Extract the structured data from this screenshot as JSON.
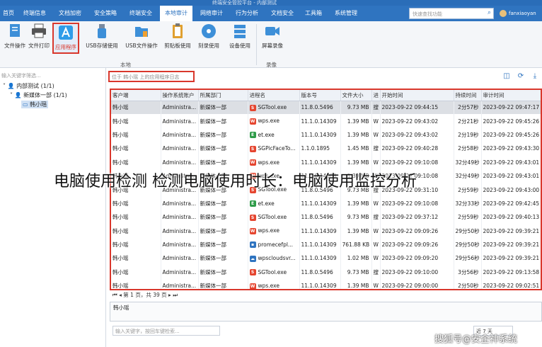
{
  "window": {
    "title": "终端安全管控平台 - 内部测试"
  },
  "menubar": {
    "items": [
      "首页",
      "终端信息",
      "文档加密",
      "安全策略",
      "终端安全",
      "本地审计",
      "网络审计",
      "行为分析",
      "文档安全",
      "工具箱",
      "系统管理"
    ],
    "active_index": 5,
    "search_placeholder": "快速查找功能",
    "username": "fanxiaoyan"
  },
  "toolbar": {
    "buttons": [
      {
        "label": "文件操作",
        "icon": "file-operation-icon"
      },
      {
        "label": "文件打印",
        "icon": "printer-icon"
      },
      {
        "label": "应用程序",
        "icon": "application-icon",
        "selected": true
      },
      {
        "label": "USB存储使用",
        "icon": "usb-storage-icon"
      },
      {
        "label": "USB文件操作",
        "icon": "usb-file-icon"
      },
      {
        "label": "剪贴板使用",
        "icon": "clipboard-icon"
      },
      {
        "label": "刻录使用",
        "icon": "disc-burn-icon"
      },
      {
        "label": "设备使用",
        "icon": "device-icon"
      },
      {
        "label": "屏幕录像",
        "icon": "screen-record-icon"
      }
    ],
    "group_local": "本地",
    "group_record": "录像"
  },
  "sidebar": {
    "search_placeholder": "输入关键字筛选...",
    "tree": [
      {
        "label": "内部测试 (1/1)",
        "level": 0
      },
      {
        "label": "新媒体一部 (1/1)",
        "level": 1
      },
      {
        "label": "韩小瑶",
        "level": 2,
        "selected": true
      }
    ]
  },
  "filter": {
    "text": "位于 韩小瑶 上的应用程序日志"
  },
  "table": {
    "columns": [
      "客户端",
      "操作系统账户",
      "所属部门",
      "进程名",
      "版本号",
      "文件大小",
      "进",
      "开始时间",
      "持续时间",
      "审计时间"
    ],
    "rows": [
      [
        "韩小瑶",
        "Administra...",
        "新媒体一部",
        "SGTool.exe",
        "11.8.0.5496",
        "9.73 MB",
        "搜",
        "2023-09-22 09:44:15",
        "2分57秒",
        "2023-09-22 09:47:17"
      ],
      [
        "韩小瑶",
        "Administra...",
        "新媒体一部",
        "wps.exe",
        "11.1.0.14309",
        "1.39 MB",
        "W",
        "2023-09-22 09:43:02",
        "2分21秒",
        "2023-09-22 09:45:26"
      ],
      [
        "韩小瑶",
        "Administra...",
        "新媒体一部",
        "et.exe",
        "11.1.0.14309",
        "1.39 MB",
        "W",
        "2023-09-22 09:43:02",
        "2分19秒",
        "2023-09-22 09:45:26"
      ],
      [
        "韩小瑶",
        "Administra...",
        "新媒体一部",
        "SGPicFaceTo...",
        "1.1.0.1895",
        "1.45 MB",
        "搜",
        "2023-09-22 09:40:28",
        "2分58秒",
        "2023-09-22 09:43:30"
      ],
      [
        "韩小瑶",
        "Administra...",
        "新媒体一部",
        "wps.exe",
        "11.1.0.14309",
        "1.39 MB",
        "W",
        "2023-09-22 09:10:08",
        "32分49秒",
        "2023-09-22 09:43:01"
      ],
      [
        "韩小瑶",
        "Administra...",
        "新媒体一部",
        "wps.exe",
        "11.1.0.14309",
        "1.39 MB",
        "W",
        "2023-09-22 09:10:08",
        "32分49秒",
        "2023-09-22 09:43:01"
      ],
      [
        "韩小瑶",
        "Administra...",
        "新媒体一部",
        "SGTool.exe",
        "11.8.0.5496",
        "9.73 MB",
        "搜",
        "2023-09-22 09:31:10",
        "2分59秒",
        "2023-09-22 09:43:00"
      ],
      [
        "韩小瑶",
        "Administra...",
        "新媒体一部",
        "et.exe",
        "11.1.0.14309",
        "1.39 MB",
        "W",
        "2023-09-22 09:10:08",
        "32分33秒",
        "2023-09-22 09:42:45"
      ],
      [
        "韩小瑶",
        "Administra...",
        "新媒体一部",
        "SGTool.exe",
        "11.8.0.5496",
        "9.73 MB",
        "搜",
        "2023-09-22 09:37:12",
        "2分59秒",
        "2023-09-22 09:40:13"
      ],
      [
        "韩小瑶",
        "Administra...",
        "新媒体一部",
        "wps.exe",
        "11.1.0.14309",
        "1.39 MB",
        "W",
        "2023-09-22 09:09:26",
        "29分50秒",
        "2023-09-22 09:39:21"
      ],
      [
        "韩小瑶",
        "Administra...",
        "新媒体一部",
        "promecefpl...",
        "11.1.0.14309",
        "761.88 KB",
        "W",
        "2023-09-22 09:09:26",
        "29分50秒",
        "2023-09-22 09:39:21"
      ],
      [
        "韩小瑶",
        "Administra...",
        "新媒体一部",
        "wpscloudsvr...",
        "11.1.0.14309",
        "1.02 MB",
        "W",
        "2023-09-22 09:09:20",
        "29分56秒",
        "2023-09-22 09:39:21"
      ],
      [
        "韩小瑶",
        "Administra...",
        "新媒体一部",
        "SGTool.exe",
        "11.8.0.5496",
        "9.73 MB",
        "搜",
        "2023-09-22 09:10:00",
        "3分56秒",
        "2023-09-22 09:13:58"
      ],
      [
        "韩小瑶",
        "Administra...",
        "新媒体一部",
        "wps.exe",
        "11.1.0.14309",
        "1.39 MB",
        "W",
        "2023-09-22 09:00:00",
        "2分50秒",
        "2023-09-22 09:02:51"
      ]
    ],
    "selected_row": 0,
    "process_icons": {
      "SGTool.exe": {
        "color": "#e5452f",
        "glyph": "S"
      },
      "wps.exe": {
        "color": "#e5452f",
        "glyph": "W"
      },
      "et.exe": {
        "color": "#2e9b48",
        "glyph": "E"
      },
      "SGPicFaceTo...": {
        "color": "#e5452f",
        "glyph": "S"
      },
      "promecefpl...": {
        "color": "#2f74c0",
        "glyph": "▪"
      },
      "wpscloudsvr...": {
        "color": "#2f74c0",
        "glyph": "☁"
      }
    }
  },
  "pager": {
    "text": "第 1 页，共 39 页"
  },
  "detail": {
    "text": "韩小瑶"
  },
  "bottom": {
    "search_placeholder": "输入关键字，按回车键检索...",
    "range": "近 7 天"
  },
  "overlay": {
    "caption": "电脑使用检测 检测电脑使用时长：电脑使用监控分析",
    "watermark": "搜狐号@安企神系统"
  },
  "colors": {
    "accent": "#2f74c0",
    "highlight": "#d9372c"
  }
}
